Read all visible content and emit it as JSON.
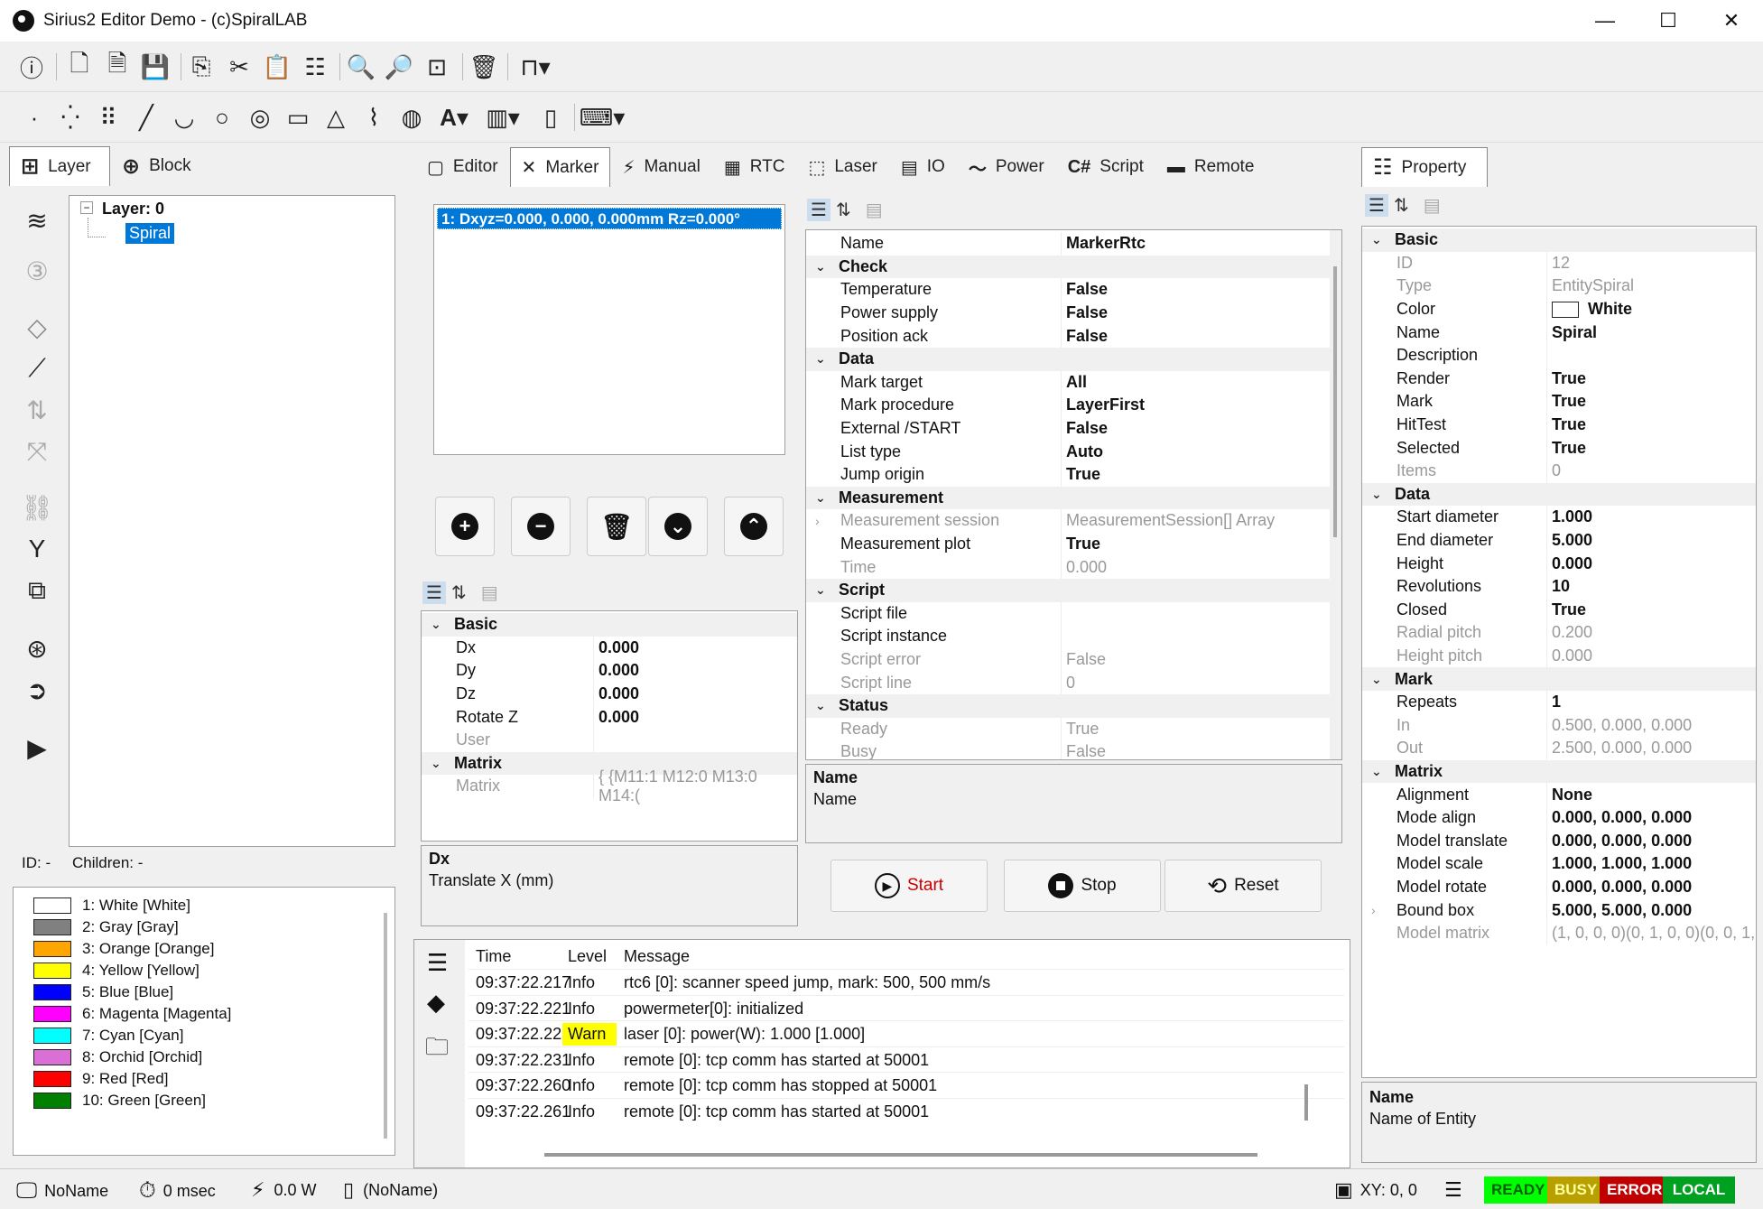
{
  "window": {
    "title": "Sirius2 Editor Demo - (c)SpiralLAB",
    "minimize": "—",
    "maximize": "☐",
    "close": "✕"
  },
  "left_tabs": [
    {
      "label": "Layer"
    },
    {
      "label": "Block"
    }
  ],
  "tree": {
    "layer": "Layer: 0",
    "entity": "Spiral"
  },
  "tree_status": {
    "id": "ID: -",
    "children": "Children: -"
  },
  "colors": [
    {
      "label": "1: White [White]",
      "hex": "#ffffff"
    },
    {
      "label": "2: Gray [Gray]",
      "hex": "#808080"
    },
    {
      "label": "3: Orange [Orange]",
      "hex": "#ffa500"
    },
    {
      "label": "4: Yellow [Yellow]",
      "hex": "#ffff00"
    },
    {
      "label": "5: Blue [Blue]",
      "hex": "#0000ff"
    },
    {
      "label": "6: Magenta [Magenta]",
      "hex": "#ff00ff"
    },
    {
      "label": "7: Cyan [Cyan]",
      "hex": "#00ffff"
    },
    {
      "label": "8: Orchid [Orchid]",
      "hex": "#da70d6"
    },
    {
      "label": "9: Red [Red]",
      "hex": "#ff0000"
    },
    {
      "label": "10: Green [Green]",
      "hex": "#008000"
    }
  ],
  "center_tabs": [
    {
      "label": "Editor",
      "icon": "editor-icon"
    },
    {
      "label": "Marker",
      "icon": "marker-icon"
    },
    {
      "label": "Manual",
      "icon": "manual-icon"
    },
    {
      "label": "RTC",
      "icon": "rtc-icon"
    },
    {
      "label": "Laser",
      "icon": "laser-icon"
    },
    {
      "label": "IO",
      "icon": "io-icon"
    },
    {
      "label": "Power",
      "icon": "power-icon"
    },
    {
      "label": "Script",
      "icon": "script-icon"
    },
    {
      "label": "Remote",
      "icon": "remote-icon"
    }
  ],
  "offsets": {
    "item": "1: Dxyz=0.000, 0.000, 0.000mm Rz=0.000°"
  },
  "offset_props": [
    {
      "type": "cat",
      "name": "Basic"
    },
    {
      "name": "Dx",
      "value": "0.000"
    },
    {
      "name": "Dy",
      "value": "0.000"
    },
    {
      "name": "Dz",
      "value": "0.000"
    },
    {
      "name": "Rotate Z",
      "value": "0.000"
    },
    {
      "name": "User",
      "value": "",
      "grey": true
    },
    {
      "type": "cat",
      "name": "Matrix"
    },
    {
      "name": "Matrix",
      "value": "{ {M11:1 M12:0 M13:0 M14:(",
      "grey": true
    }
  ],
  "offset_desc": {
    "title": "Dx",
    "text": "Translate X (mm)"
  },
  "marker_props": [
    {
      "name": "Name",
      "value": "MarkerRtc"
    },
    {
      "type": "cat",
      "name": "Check"
    },
    {
      "name": "Temperature",
      "value": "False"
    },
    {
      "name": "Power supply",
      "value": "False"
    },
    {
      "name": "Position ack",
      "value": "False"
    },
    {
      "type": "cat",
      "name": "Data"
    },
    {
      "name": "Mark target",
      "value": "All"
    },
    {
      "name": "Mark procedure",
      "value": "LayerFirst"
    },
    {
      "name": "External /START",
      "value": "False"
    },
    {
      "name": "List type",
      "value": "Auto"
    },
    {
      "name": "Jump origin",
      "value": "True"
    },
    {
      "type": "cat",
      "name": "Measurement"
    },
    {
      "name": "Measurement session",
      "value": "MeasurementSession[] Array",
      "grey": true,
      "expand": true
    },
    {
      "name": "Measurement plot",
      "value": "True"
    },
    {
      "name": "Time",
      "value": "0.000",
      "grey": true
    },
    {
      "type": "cat",
      "name": "Script"
    },
    {
      "name": "Script file",
      "value": ""
    },
    {
      "name": "Script instance",
      "value": ""
    },
    {
      "name": "Script error",
      "value": "False",
      "grey": true
    },
    {
      "name": "Script line",
      "value": "0",
      "grey": true
    },
    {
      "type": "cat",
      "name": "Status"
    },
    {
      "name": "Ready",
      "value": "True",
      "grey": true
    },
    {
      "name": "Busy",
      "value": "False",
      "grey": true
    }
  ],
  "marker_desc": {
    "title": "Name",
    "text": "Name"
  },
  "marker_buttons": {
    "start": "Start",
    "stop": "Stop",
    "reset": "Reset"
  },
  "log": {
    "headers": {
      "time": "Time",
      "level": "Level",
      "message": "Message"
    },
    "rows": [
      {
        "time": "09:37:22.217",
        "level": "Info",
        "message": "rtc6 [0]: scanner speed jump, mark: 500, 500 mm/s"
      },
      {
        "time": "09:37:22.221",
        "level": "Info",
        "message": "powermeter[0]: initialized"
      },
      {
        "time": "09:37:22.228",
        "level": "Warn",
        "message": "laser [0]: power(W): 1.000 [1.000]"
      },
      {
        "time": "09:37:22.231",
        "level": "Info",
        "message": "remote [0]: tcp comm has started at 50001"
      },
      {
        "time": "09:37:22.260",
        "level": "Info",
        "message": "remote [0]: tcp comm has stopped at 50001"
      },
      {
        "time": "09:37:22.261",
        "level": "Info",
        "message": "remote [0]: tcp comm has started at 50001"
      }
    ],
    "warn_color": "#ffff00"
  },
  "property_tab": "Property",
  "entity_props": [
    {
      "type": "cat",
      "name": "Basic"
    },
    {
      "name": "ID",
      "value": "12",
      "grey": true
    },
    {
      "name": "Type",
      "value": "EntitySpiral",
      "grey": true
    },
    {
      "name": "Color",
      "value": "White",
      "swatch": true
    },
    {
      "name": "Name",
      "value": "Spiral"
    },
    {
      "name": "Description",
      "value": ""
    },
    {
      "name": "Render",
      "value": "True"
    },
    {
      "name": "Mark",
      "value": "True"
    },
    {
      "name": "HitTest",
      "value": "True"
    },
    {
      "name": "Selected",
      "value": "True"
    },
    {
      "name": "Items",
      "value": "0",
      "grey": true
    },
    {
      "type": "cat",
      "name": "Data"
    },
    {
      "name": "Start diameter",
      "value": "1.000"
    },
    {
      "name": "End diameter",
      "value": "5.000"
    },
    {
      "name": "Height",
      "value": "0.000"
    },
    {
      "name": "Revolutions",
      "value": "10"
    },
    {
      "name": "Closed",
      "value": "True"
    },
    {
      "name": "Radial pitch",
      "value": "0.200",
      "grey": true
    },
    {
      "name": "Height pitch",
      "value": "0.000",
      "grey": true
    },
    {
      "type": "cat",
      "name": "Mark"
    },
    {
      "name": "Repeats",
      "value": "1"
    },
    {
      "name": "In",
      "value": "0.500, 0.000, 0.000",
      "grey": true
    },
    {
      "name": "Out",
      "value": "2.500, 0.000, 0.000",
      "grey": true
    },
    {
      "type": "cat",
      "name": "Matrix"
    },
    {
      "name": "Alignment",
      "value": "None"
    },
    {
      "name": "Mode align",
      "value": "0.000, 0.000, 0.000"
    },
    {
      "name": "Model translate",
      "value": "0.000, 0.000, 0.000"
    },
    {
      "name": "Model scale",
      "value": "1.000, 1.000, 1.000"
    },
    {
      "name": "Model rotate",
      "value": "0.000, 0.000, 0.000"
    },
    {
      "name": "Bound box",
      "value": "5.000, 5.000, 0.000",
      "expand": true
    },
    {
      "name": "Model matrix",
      "value": "(1, 0, 0, 0)(0, 1, 0, 0)(0, 0, 1,",
      "grey": true
    }
  ],
  "entity_desc": {
    "title": "Name",
    "text": "Name of Entity"
  },
  "statusbar": {
    "name": "NoName",
    "time": "0 msec",
    "power": "0.0 W",
    "file": "(NoName)",
    "xy": "XY: 0, 0",
    "ready": "READY",
    "busy": "BUSY",
    "error": "ERROR",
    "local": "LOCAL"
  },
  "badge_colors": {
    "ready": "#00ff00",
    "busy": "#b8a000",
    "error": "#c00000",
    "local": "#00a020"
  }
}
